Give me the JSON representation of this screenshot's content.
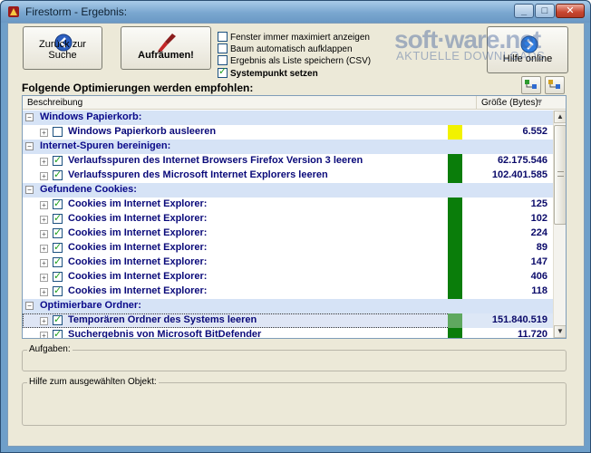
{
  "window": {
    "title": "Firestorm - Ergebnis:",
    "minimize": "_",
    "maximize": "□",
    "close": "✕"
  },
  "toolbar": {
    "back_label": "Zurück zur Suche",
    "cleanup_label": "Aufräumen!",
    "help_online_label": "Hilfe online"
  },
  "options": [
    {
      "label": "Fenster immer maximiert anzeigen",
      "checked": false,
      "bold": false
    },
    {
      "label": "Baum automatisch aufklappen",
      "checked": false,
      "bold": false
    },
    {
      "label": "Ergebnis als Liste speichern (CSV)",
      "checked": false,
      "bold": false
    },
    {
      "label": "Systempunkt setzen",
      "checked": true,
      "bold": true
    }
  ],
  "watermark": {
    "logo": "soft·ware.net",
    "tagline": "AKTUELLE DOWNLOADS"
  },
  "section_label": "Folgende Optimierungen werden empfohlen:",
  "list": {
    "header_description": "Beschreibung",
    "header_size": "Größe (Bytes):",
    "rows": [
      {
        "type": "cat",
        "label": "Windows Papierkorb:"
      },
      {
        "type": "item",
        "label": "Windows Papierkorb ausleeren",
        "checked": false,
        "status": "yellow",
        "value": "6.552"
      },
      {
        "type": "cat",
        "label": "Internet-Spuren bereinigen:"
      },
      {
        "type": "item",
        "label": "Verlaufsspuren des Internet Browsers Firefox Version 3 leeren",
        "checked": true,
        "status": "green",
        "value": "62.175.546"
      },
      {
        "type": "item",
        "label": "Verlaufsspuren des Microsoft Internet Explorers leeren",
        "checked": true,
        "status": "green",
        "value": "102.401.585"
      },
      {
        "type": "cat",
        "label": "Gefundene Cookies:"
      },
      {
        "type": "item",
        "label": "Cookies im Internet Explorer:",
        "checked": true,
        "status": "green",
        "value": "125"
      },
      {
        "type": "item",
        "label": "Cookies im Internet Explorer:",
        "checked": true,
        "status": "green",
        "value": "102"
      },
      {
        "type": "item",
        "label": "Cookies im Internet Explorer:",
        "checked": true,
        "status": "green",
        "value": "224"
      },
      {
        "type": "item",
        "label": "Cookies im Internet Explorer:",
        "checked": true,
        "status": "green",
        "value": "89"
      },
      {
        "type": "item",
        "label": "Cookies im Internet Explorer:",
        "checked": true,
        "status": "green",
        "value": "147"
      },
      {
        "type": "item",
        "label": "Cookies im Internet Explorer:",
        "checked": true,
        "status": "green",
        "value": "406"
      },
      {
        "type": "item",
        "label": "Cookies im Internet Explorer:",
        "checked": true,
        "status": "green",
        "value": "118"
      },
      {
        "type": "cat",
        "label": "Optimierbare Ordner:"
      },
      {
        "type": "item",
        "label": "Temporären Ordner des Systems leeren",
        "checked": true,
        "status": "lightgreen",
        "value": "151.840.519",
        "selected": true
      },
      {
        "type": "item",
        "label": "Suchergebnis von Microsoft BitDefender",
        "checked": true,
        "status": "green",
        "value": "11.720"
      }
    ]
  },
  "status_colors": {
    "green": "#0a7d0a",
    "lightgreen": "#5fa85f",
    "yellow": "#f2f200"
  },
  "tasks_label": "Aufgaben:",
  "help_label": "Hilfe zum ausgewählten Objekt:"
}
